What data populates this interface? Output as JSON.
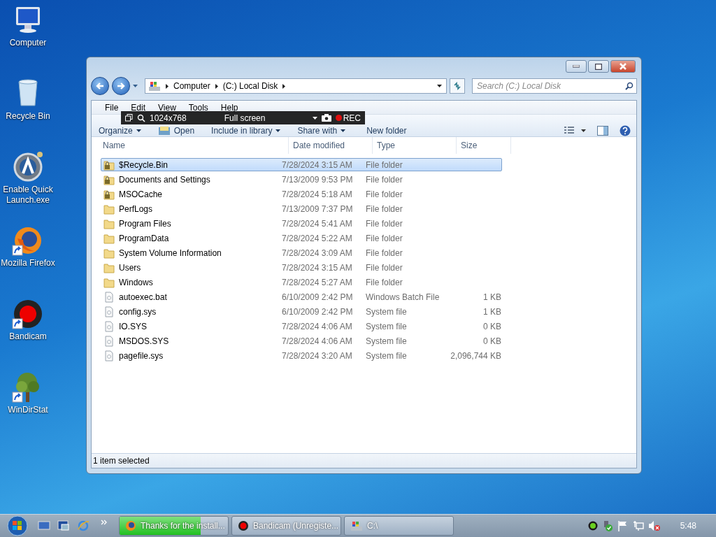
{
  "desktop": {
    "icons": [
      {
        "label": "Computer",
        "kind": "computer",
        "shortcut": false
      },
      {
        "label": "Recycle Bin",
        "kind": "recycle-bin",
        "shortcut": false
      },
      {
        "label": "Enable Quick Launch.exe",
        "kind": "app",
        "shortcut": false
      },
      {
        "label": "Mozilla Firefox",
        "kind": "browser",
        "shortcut": true
      },
      {
        "label": "Bandicam",
        "kind": "recorder",
        "shortcut": true
      },
      {
        "label": "WinDirStat",
        "kind": "tree",
        "shortcut": true
      }
    ]
  },
  "window": {
    "breadcrumb": [
      "Computer",
      "(C:) Local Disk"
    ],
    "search": {
      "placeholder": "Search (C:) Local Disk"
    },
    "menu": [
      "File",
      "Edit",
      "View",
      "Tools",
      "Help"
    ],
    "toolbar": [
      {
        "label": "Organize",
        "kind": "dropdown"
      },
      {
        "label": "Open",
        "kind": "open"
      },
      {
        "label": "Include in library",
        "kind": "dropdown"
      },
      {
        "label": "Share with",
        "kind": "dropdown"
      },
      {
        "label": "New folder",
        "kind": "button"
      }
    ],
    "columns": [
      "Name",
      "Date modified",
      "Type",
      "Size"
    ],
    "rows": [
      {
        "name": "$Recycle.Bin",
        "date": "7/28/2024 3:15 AM",
        "type": "File folder",
        "kind": "locked-folder",
        "selected": true
      },
      {
        "name": "Documents and Settings",
        "date": "7/13/2009 9:53 PM",
        "type": "File folder",
        "kind": "locked-folder",
        "selected": false
      },
      {
        "name": "MSOCache",
        "date": "7/28/2024 5:18 AM",
        "type": "File folder",
        "kind": "locked-folder",
        "selected": false
      },
      {
        "name": "PerfLogs",
        "date": "7/13/2009 7:37 PM",
        "type": "File folder",
        "kind": "folder",
        "selected": false
      },
      {
        "name": "Program Files",
        "date": "7/28/2024 5:41 AM",
        "type": "File folder",
        "kind": "folder",
        "selected": false
      },
      {
        "name": "ProgramData",
        "date": "7/28/2024 5:22 AM",
        "type": "File folder",
        "kind": "folder",
        "selected": false
      },
      {
        "name": "System Volume Information",
        "date": "7/28/2024 3:09 AM",
        "type": "File folder",
        "kind": "folder",
        "selected": false
      },
      {
        "name": "Users",
        "date": "7/28/2024 3:15 AM",
        "type": "File folder",
        "kind": "folder",
        "selected": false
      },
      {
        "name": "Windows",
        "date": "7/28/2024 5:27 AM",
        "type": "File folder",
        "kind": "folder",
        "selected": false
      },
      {
        "name": "autoexec.bat",
        "date": "6/10/2009 2:42 PM",
        "type": "Windows Batch File",
        "size": "1 KB",
        "kind": "file",
        "selected": false
      },
      {
        "name": "config.sys",
        "date": "6/10/2009 2:42 PM",
        "type": "System file",
        "size": "1 KB",
        "kind": "file",
        "selected": false
      },
      {
        "name": "IO.SYS",
        "date": "7/28/2024 4:06 AM",
        "type": "System file",
        "size": "0 KB",
        "kind": "file",
        "selected": false
      },
      {
        "name": "MSDOS.SYS",
        "date": "7/28/2024 4:06 AM",
        "type": "System file",
        "size": "0 KB",
        "kind": "file",
        "selected": false
      },
      {
        "name": "pagefile.sys",
        "date": "7/28/2024 3:20 AM",
        "type": "System file",
        "size": "2,096,744 KB",
        "kind": "file",
        "selected": false
      }
    ],
    "status_bar": "1 item selected"
  },
  "recorder_bar": {
    "resolution": "1024x768",
    "mode": "Full screen",
    "rec": "REC"
  },
  "taskbar": {
    "items": [
      {
        "label": "Thanks for the install...",
        "kind": "browser",
        "level": 0.75
      },
      {
        "label": "Bandicam (Unregiste...",
        "kind": "recorder"
      },
      {
        "label": "C:\\",
        "kind": "explorer"
      }
    ],
    "clock": "5:48"
  }
}
